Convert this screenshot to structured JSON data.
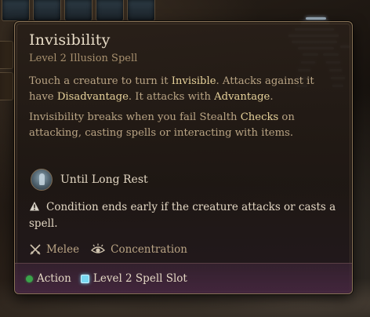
{
  "tooltip": {
    "title": "Invisibility",
    "subtitle": "Level 2 Illusion Spell",
    "description": {
      "p1": {
        "pre": "Touch a creature to turn it ",
        "kw1": "Invisible",
        "mid1": ". Attacks against it have ",
        "kw2": "Disadvantage",
        "mid2": ". It attacks with ",
        "kw3": "Advantage",
        "post": "."
      },
      "p2": {
        "pre": "Invisibility breaks when you fail Stealth ",
        "kw1": "Checks",
        "post": " on attacking, casting spells or interacting with items."
      }
    },
    "duration": {
      "icon": "invisible-figure-icon",
      "label": "Until Long Rest"
    },
    "condition": {
      "icon": "warning-icon",
      "text": "Condition ends early if the creature attacks or casts a spell."
    },
    "properties": [
      {
        "icon": "crossed-swords-icon",
        "label": "Melee"
      },
      {
        "icon": "concentration-eye-icon",
        "label": "Concentration"
      }
    ],
    "costs": [
      {
        "icon": "action-dot-icon",
        "label": "Action",
        "color": "#3aa34a"
      },
      {
        "icon": "spell-slot-gem-icon",
        "label": "Level 2 Spell Slot",
        "color": "#79d8f2"
      }
    ]
  },
  "colors": {
    "keyword": "#e6d19a",
    "title": "#e9ddc8",
    "subtitle": "#a8906e",
    "body": "#b9a484",
    "border": "#8a7457"
  }
}
